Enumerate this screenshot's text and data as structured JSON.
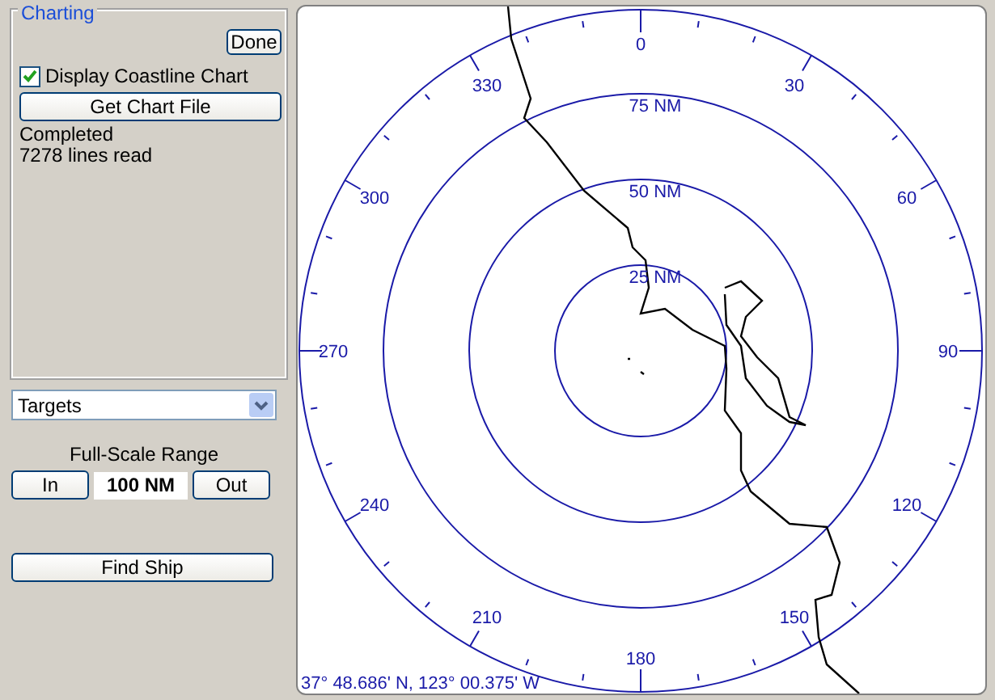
{
  "charting": {
    "title": "Charting",
    "done_button": "Done",
    "coastline_checkbox": {
      "label": "Display Coastline Chart",
      "checked": true
    },
    "get_chart_button": "Get Chart File",
    "status_lines": [
      "Completed",
      "7278 lines read"
    ]
  },
  "view_dropdown": {
    "value": "Targets"
  },
  "range": {
    "label": "Full-Scale Range",
    "in_button": "In",
    "value": "100 NM",
    "out_button": "Out"
  },
  "find_ship_button": "Find Ship",
  "radar": {
    "ring_labels": [
      "75 NM",
      "50 NM",
      "25 NM"
    ],
    "bearing_labels": [
      "0",
      "30",
      "60",
      "90",
      "120",
      "150",
      "180",
      "210",
      "240",
      "270",
      "300",
      "330"
    ],
    "position": "37° 48.686' N, 123° 00.375' W"
  }
}
